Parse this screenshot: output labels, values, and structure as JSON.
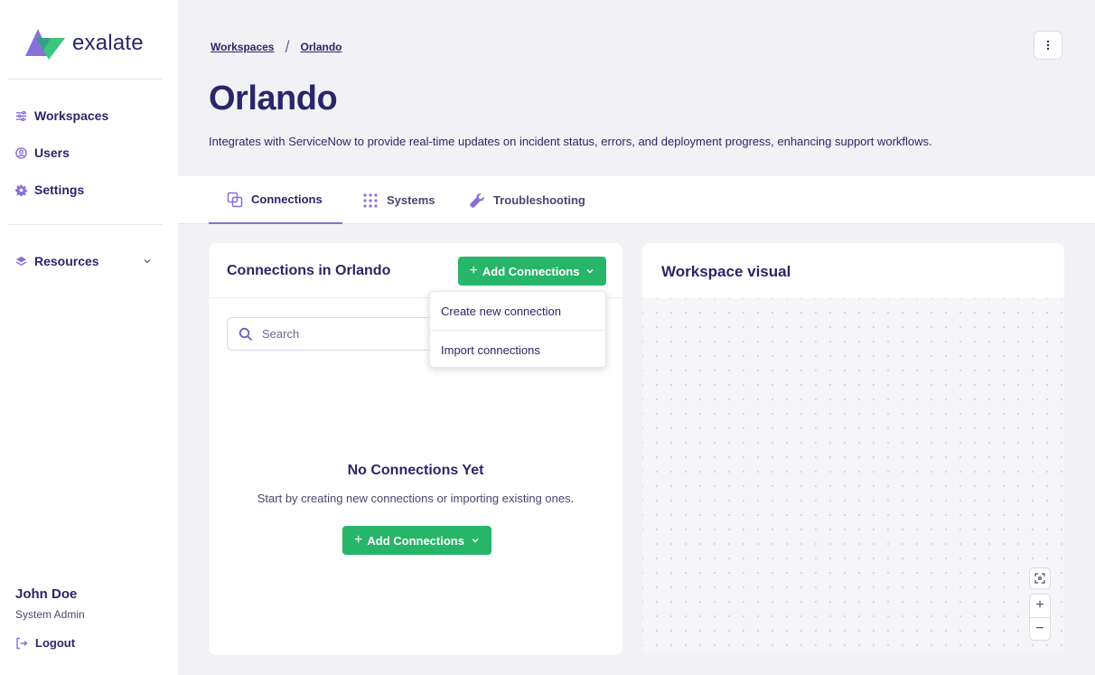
{
  "brand": {
    "name": "exalate"
  },
  "sidebar": {
    "items": [
      {
        "label": "Workspaces",
        "icon": "workspaces-icon"
      },
      {
        "label": "Users",
        "icon": "user-circle-icon"
      },
      {
        "label": "Settings",
        "icon": "gear-icon"
      },
      {
        "label": "Resources",
        "icon": "layers-icon"
      }
    ],
    "user": {
      "name": "John Doe",
      "role": "System Admin"
    },
    "logout_label": "Logout"
  },
  "breadcrumb": {
    "items": [
      "Workspaces",
      "Orlando"
    ],
    "separator": "/"
  },
  "page": {
    "title": "Orlando",
    "description": "Integrates with ServiceNow to provide real-time updates on incident status, errors, and deployment progress, enhancing support workflows."
  },
  "tabs": [
    {
      "label": "Connections",
      "icon": "connections-icon",
      "active": true
    },
    {
      "label": "Systems",
      "icon": "grid-dots-icon",
      "active": false
    },
    {
      "label": "Troubleshooting",
      "icon": "wrench-icon",
      "active": false
    }
  ],
  "connections_panel": {
    "title": "Connections in Orlando",
    "add_button_label": "Add Connections",
    "search_placeholder": "Search",
    "empty_title": "No Connections Yet",
    "empty_subtitle": "Start by creating new connections or importing existing ones.",
    "empty_button_label": "Add Connections",
    "dropdown_items": [
      "Create new connection",
      "Import connections"
    ]
  },
  "workspace_panel": {
    "title": "Workspace visual",
    "controls": {
      "zoom_in": "+",
      "zoom_out": "−"
    }
  },
  "colors": {
    "accent_purple": "#8b6fd9",
    "primary_text": "#2b2669",
    "green_button": "#27b56a",
    "page_background": "#f2f1f6"
  }
}
